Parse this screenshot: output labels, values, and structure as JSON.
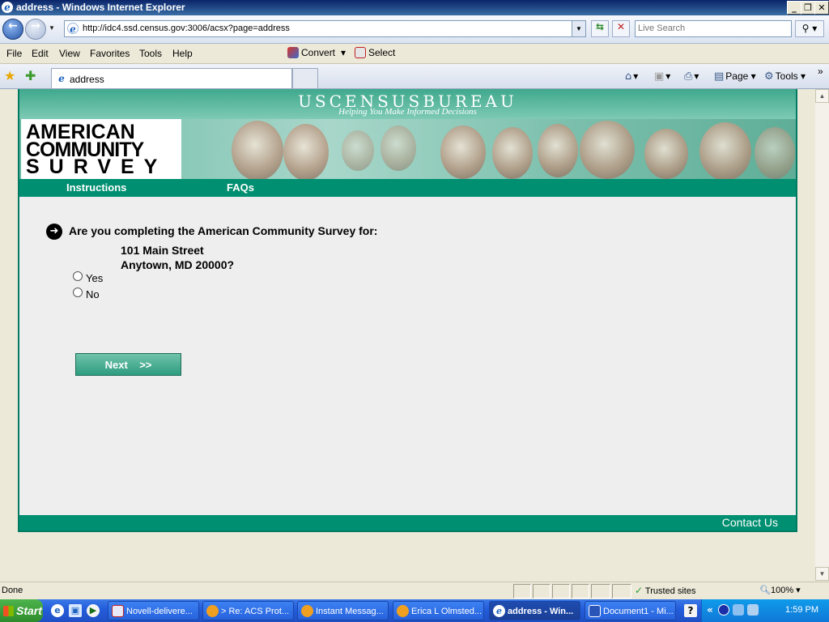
{
  "window": {
    "title": "address - Windows Internet Explorer"
  },
  "nav": {
    "url": "http://idc4.ssd.census.gov:3006/acsx?page=address",
    "search_placeholder": "Live Search"
  },
  "menu": {
    "items": [
      "File",
      "Edit",
      "View",
      "Favorites",
      "Tools",
      "Help"
    ],
    "convert": "Convert",
    "select": "Select"
  },
  "tabs": {
    "active_label": "address",
    "page_label": "Page",
    "tools_label": "Tools"
  },
  "census": {
    "title": "USCENSUSBUREAU",
    "tagline": "Helping You Make Informed Decisions"
  },
  "acs_logo": {
    "line1": "AMERICAN",
    "line2": "COMMUNITY",
    "line3": "SURVEY"
  },
  "acs_nav": {
    "instructions": "Instructions",
    "faqs": "FAQs"
  },
  "question": {
    "text": "Are you completing the American Community Survey for:",
    "address_line1": "101 Main Street",
    "address_line2": "Anytown, MD 20000?",
    "options": [
      "Yes",
      "No"
    ],
    "next_label": "Next    >>"
  },
  "footer": {
    "contact": "Contact Us"
  },
  "status": {
    "text": "Done",
    "zone": "Trusted sites",
    "zoom": "100%"
  },
  "taskbar": {
    "start": "Start",
    "buttons": [
      {
        "label": "Novell-delivere...",
        "active": false
      },
      {
        "label": "> Re: ACS Prot...",
        "active": false
      },
      {
        "label": "Instant Messag...",
        "active": false
      },
      {
        "label": "Erica L Olmsted...",
        "active": false
      },
      {
        "label": "address - Win...",
        "active": true
      },
      {
        "label": "Document1 - Mi...",
        "active": false
      }
    ],
    "clock": "1:59 PM"
  },
  "colors": {
    "census_green": "#008F70",
    "banner_green": "#3FA98D",
    "taskbar_blue": "#245EDC"
  }
}
